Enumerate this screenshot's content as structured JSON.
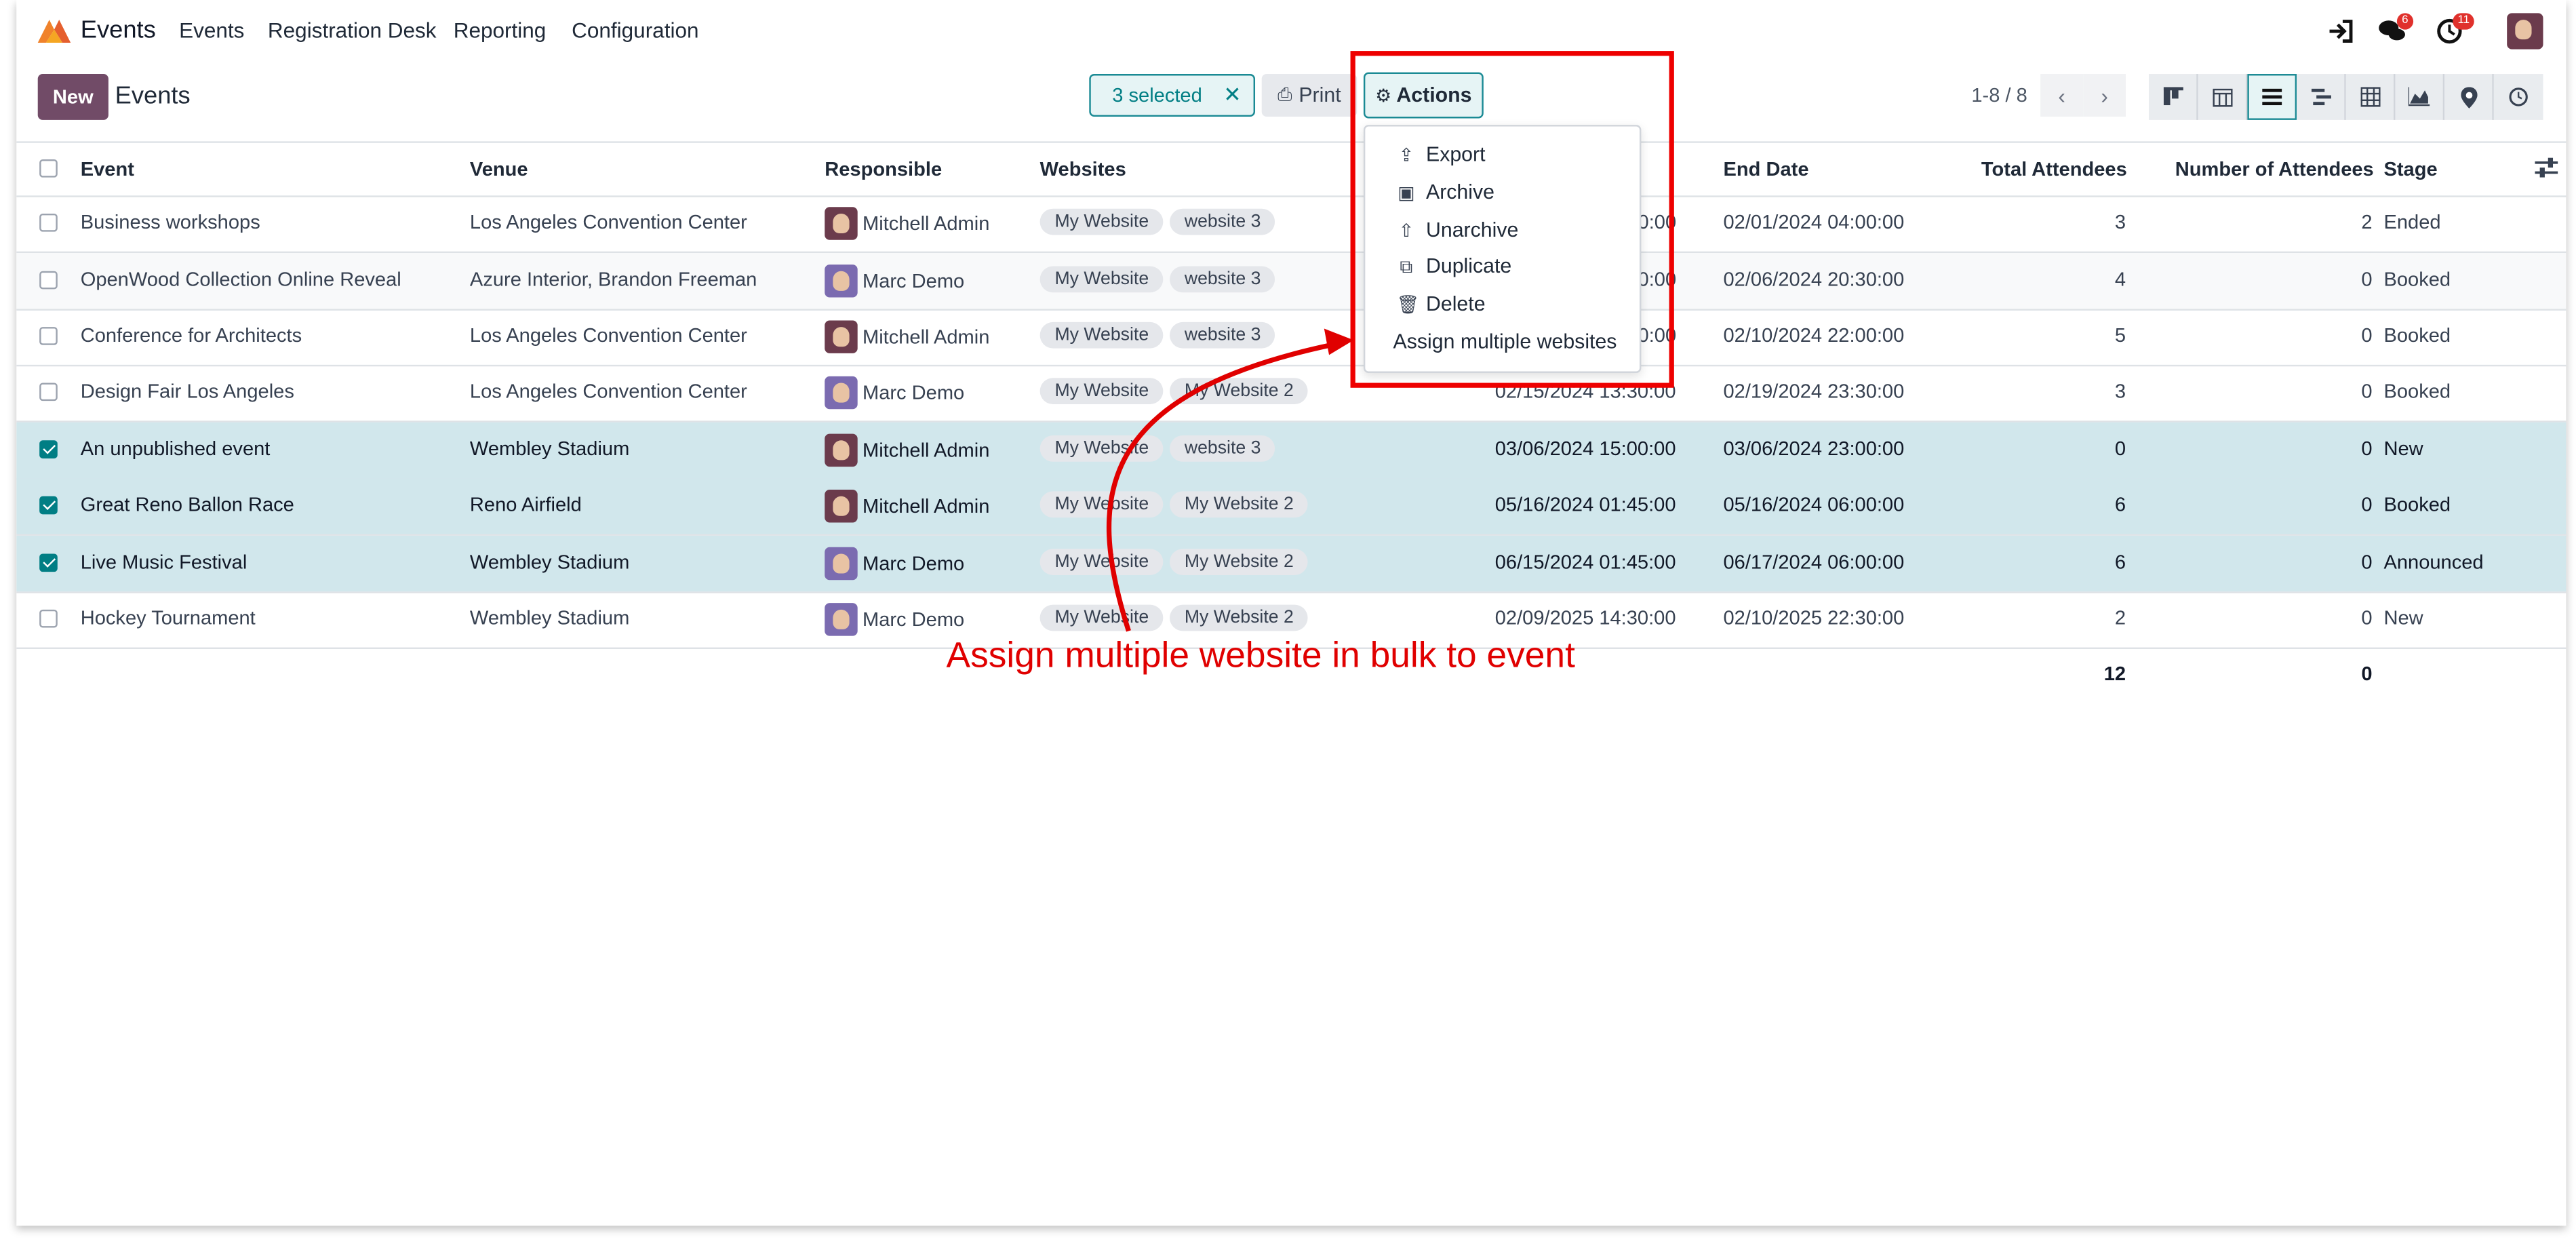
{
  "app": {
    "brand": "Events",
    "accent": "#714b67",
    "teal": "#017e84"
  },
  "topnav": {
    "menu": [
      "Events",
      "Registration Desk",
      "Reporting",
      "Configuration"
    ],
    "messages_count": "6",
    "activities_count": "11"
  },
  "control": {
    "new_label": "New",
    "title": "Events",
    "selected_label": "3 selected",
    "print_label": "Print",
    "actions_label": "Actions",
    "pager": "1-8 / 8"
  },
  "views": [
    "kanban-icon",
    "calendar-icon",
    "list-icon",
    "gantt-icon",
    "pivot-icon",
    "graph-icon",
    "map-icon",
    "activity-icon"
  ],
  "table": {
    "headers": [
      "Event",
      "Venue",
      "Responsible",
      "Websites",
      "End Date",
      "Total Attendees",
      "Number of Attendees",
      "Stage"
    ],
    "rows": [
      {
        "selected": false,
        "event": "Business workshops",
        "venue": "Los Angeles Convention Center",
        "responsible": "Mitchell Admin",
        "avatar": "mitchell",
        "websites": [
          "My Website",
          "website 3"
        ],
        "start": "",
        "start_partial": "0:00",
        "end": "02/01/2024 04:00:00",
        "total": "3",
        "number": "2",
        "stage": "Ended"
      },
      {
        "selected": false,
        "event": "OpenWood Collection Online Reveal",
        "venue": "Azure Interior, Brandon Freeman",
        "responsible": "Marc Demo",
        "avatar": "marc",
        "websites": [
          "My Website",
          "website 3"
        ],
        "start": "",
        "start_partial": "0:00",
        "end": "02/06/2024 20:30:00",
        "total": "4",
        "number": "0",
        "stage": "Booked"
      },
      {
        "selected": false,
        "event": "Conference for Architects",
        "venue": "Los Angeles Convention Center",
        "responsible": "Mitchell Admin",
        "avatar": "mitchell",
        "websites": [
          "My Website",
          "website 3"
        ],
        "start": "",
        "start_partial": "0:00",
        "end": "02/10/2024 22:00:00",
        "total": "5",
        "number": "0",
        "stage": "Booked"
      },
      {
        "selected": false,
        "event": "Design Fair Los Angeles",
        "venue": "Los Angeles Convention Center",
        "responsible": "Marc Demo",
        "avatar": "marc",
        "websites": [
          "My Website",
          "My Website 2"
        ],
        "start": "02/15/2024 13:30:00",
        "start_partial": "",
        "end": "02/19/2024 23:30:00",
        "total": "3",
        "number": "0",
        "stage": "Booked"
      },
      {
        "selected": true,
        "event": "An unpublished event",
        "venue": "Wembley Stadium",
        "responsible": "Mitchell Admin",
        "avatar": "mitchell",
        "websites": [
          "My Website",
          "website 3"
        ],
        "start": "03/06/2024 15:00:00",
        "start_partial": "",
        "end": "03/06/2024 23:00:00",
        "total": "0",
        "number": "0",
        "stage": "New"
      },
      {
        "selected": true,
        "event": "Great Reno Ballon Race",
        "venue": "Reno Airfield",
        "responsible": "Mitchell Admin",
        "avatar": "mitchell",
        "websites": [
          "My Website",
          "My Website 2"
        ],
        "start": "05/16/2024 01:45:00",
        "start_partial": "",
        "end": "05/16/2024 06:00:00",
        "total": "6",
        "number": "0",
        "stage": "Booked"
      },
      {
        "selected": true,
        "event": "Live Music Festival",
        "venue": "Wembley Stadium",
        "responsible": "Marc Demo",
        "avatar": "marc",
        "websites": [
          "My Website",
          "My Website 2"
        ],
        "start": "06/15/2024 01:45:00",
        "start_partial": "",
        "end": "06/17/2024 06:00:00",
        "total": "6",
        "number": "0",
        "stage": "Announced"
      },
      {
        "selected": false,
        "event": "Hockey Tournament",
        "venue": "Wembley Stadium",
        "responsible": "Marc Demo",
        "avatar": "marc",
        "websites": [
          "My Website",
          "My Website 2"
        ],
        "start": "02/09/2025 14:30:00",
        "start_partial": "",
        "end": "02/10/2025 22:30:00",
        "total": "2",
        "number": "0",
        "stage": "New"
      }
    ],
    "totals": {
      "total": "12",
      "number": "0"
    }
  },
  "actions_menu": {
    "items": [
      {
        "label": "Export",
        "icon": "upload-icon"
      },
      {
        "label": "Archive",
        "icon": "archive-icon"
      },
      {
        "label": "Unarchive",
        "icon": "unarchive-icon"
      },
      {
        "label": "Duplicate",
        "icon": "copy-icon"
      },
      {
        "label": "Delete",
        "icon": "trash-icon"
      },
      {
        "label": "Assign multiple websites",
        "icon": ""
      }
    ]
  },
  "annotation": {
    "text": "Assign multiple website in bulk to event",
    "color": "#e00000"
  }
}
